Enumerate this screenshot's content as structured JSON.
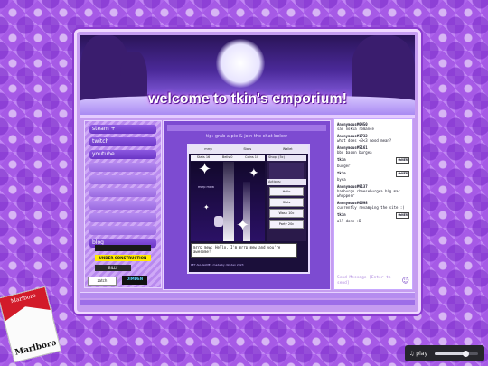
{
  "site": {
    "title": "welcome to tkin's emporium!",
    "main_heading": "",
    "main_subheading": "tip: grab a pie & join the chat below"
  },
  "nav": {
    "items": [
      {
        "label": "steam +"
      },
      {
        "label": "twitch"
      },
      {
        "label": "youtube"
      },
      {
        "label": ""
      },
      {
        "label": ""
      },
      {
        "label": ""
      },
      {
        "label": ""
      },
      {
        "label": ""
      },
      {
        "label": ""
      },
      {
        "label": "blog"
      }
    ]
  },
  "badges": {
    "b1": "",
    "under_construction": "UNDER CONSTRUCTION",
    "billy": "BILLY",
    "zatch": "zatch",
    "dimden": "DIMDEN"
  },
  "game": {
    "header": [
      "mrrp",
      "Stats",
      "Wallet"
    ],
    "stats": [
      "Stats 16",
      "Bells 0",
      "Coins 10"
    ],
    "shop_label": "Shop: (5c)",
    "actions_label": "Actions:",
    "buttons": [
      "Hello",
      "Slots",
      "Wash 10c",
      "Party 20c"
    ],
    "player_label": "mrrp mew",
    "chat_line": "mrrp mew: Hello, I'm mrrp mew and you're awesome!",
    "footer": "PET ALL GAME  ·  made by dimden 2023"
  },
  "chat": {
    "messages": [
      {
        "user": "Anonymous#0450",
        "tag": "",
        "text": "sad nokia romance"
      },
      {
        "user": "Anonymous#1732",
        "tag": "",
        "text": "what does <3<3 mood mean?"
      },
      {
        "user": "Anonymous#5161",
        "tag": "",
        "text": "bbq bacon burgea"
      },
      {
        "user": "tkin",
        "tag": "OWNER",
        "text": "burger"
      },
      {
        "user": "tkin",
        "tag": "OWNER",
        "text": "byea"
      },
      {
        "user": "Anonymous#9137",
        "tag": "",
        "text": "hamburgo cheeseburgea big mac whopperr"
      },
      {
        "user": "Anonymous#0698",
        "tag": "",
        "text": "currently revamping the site :)"
      },
      {
        "user": "tkin",
        "tag": "OWNER",
        "text": "all done :D"
      }
    ],
    "input_placeholder": "Send Message [Enter to send]"
  },
  "pack": {
    "brand": "Marlboro"
  },
  "player": {
    "label": "play",
    "progress": 0.7
  }
}
